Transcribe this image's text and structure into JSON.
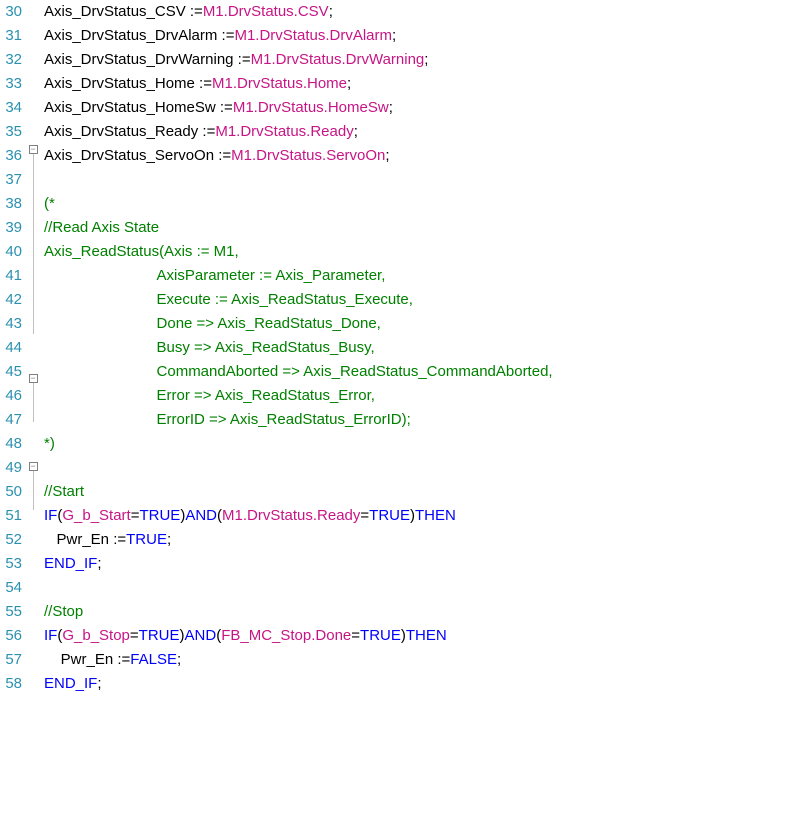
{
  "lines": [
    {
      "num": 30,
      "fold": "",
      "segments": [
        {
          "t": "Axis_DrvStatus_CSV := ",
          "c": "tok-default"
        },
        {
          "t": "M1.DrvStatus.CSV",
          "c": "tok-member"
        },
        {
          "t": ";",
          "c": "tok-default"
        }
      ]
    },
    {
      "num": 31,
      "fold": "",
      "segments": [
        {
          "t": "Axis_DrvStatus_DrvAlarm := ",
          "c": "tok-default"
        },
        {
          "t": "M1.DrvStatus.DrvAlarm",
          "c": "tok-member"
        },
        {
          "t": ";",
          "c": "tok-default"
        }
      ]
    },
    {
      "num": 32,
      "fold": "",
      "segments": [
        {
          "t": "Axis_DrvStatus_DrvWarning := ",
          "c": "tok-default"
        },
        {
          "t": "M1.DrvStatus.DrvWarning",
          "c": "tok-member"
        },
        {
          "t": ";",
          "c": "tok-default"
        }
      ]
    },
    {
      "num": 33,
      "fold": "",
      "segments": [
        {
          "t": "Axis_DrvStatus_Home := ",
          "c": "tok-default"
        },
        {
          "t": "M1.DrvStatus.Home",
          "c": "tok-member"
        },
        {
          "t": ";",
          "c": "tok-default"
        }
      ]
    },
    {
      "num": 34,
      "fold": "",
      "segments": [
        {
          "t": "Axis_DrvStatus_HomeSw := ",
          "c": "tok-default"
        },
        {
          "t": "M1.DrvStatus.HomeSw",
          "c": "tok-member"
        },
        {
          "t": ";",
          "c": "tok-default"
        }
      ]
    },
    {
      "num": 35,
      "fold": "",
      "segments": [
        {
          "t": "Axis_DrvStatus_Ready := ",
          "c": "tok-default"
        },
        {
          "t": "M1.DrvStatus.Ready",
          "c": "tok-member"
        },
        {
          "t": ";",
          "c": "tok-default"
        }
      ]
    },
    {
      "num": 36,
      "fold": "",
      "segments": [
        {
          "t": "Axis_DrvStatus_ServoOn := ",
          "c": "tok-default"
        },
        {
          "t": "M1.DrvStatus.ServoOn",
          "c": "tok-member"
        },
        {
          "t": ";",
          "c": "tok-default"
        }
      ]
    },
    {
      "num": 37,
      "fold": "",
      "segments": []
    },
    {
      "num": 38,
      "fold": "box",
      "segments": [
        {
          "t": "(*",
          "c": "tok-comment"
        }
      ]
    },
    {
      "num": 39,
      "fold": "v",
      "segments": [
        {
          "t": "//Read Axis State",
          "c": "tok-comment"
        }
      ]
    },
    {
      "num": 40,
      "fold": "v",
      "segments": [
        {
          "t": "Axis_ReadStatus(Axis := M1,",
          "c": "tok-comment"
        }
      ]
    },
    {
      "num": 41,
      "fold": "v",
      "segments": [
        {
          "t": "                           AxisParameter := Axis_Parameter,",
          "c": "tok-comment"
        }
      ]
    },
    {
      "num": 42,
      "fold": "v",
      "segments": [
        {
          "t": "                           Execute := Axis_ReadStatus_Execute,",
          "c": "tok-comment"
        }
      ]
    },
    {
      "num": 43,
      "fold": "v",
      "segments": [
        {
          "t": "                           Done => Axis_ReadStatus_Done,",
          "c": "tok-comment"
        }
      ]
    },
    {
      "num": 44,
      "fold": "v",
      "segments": [
        {
          "t": "                           Busy => Axis_ReadStatus_Busy,",
          "c": "tok-comment"
        }
      ]
    },
    {
      "num": 45,
      "fold": "v",
      "segments": [
        {
          "t": "                           CommandAborted => Axis_ReadStatus_CommandAborted,",
          "c": "tok-comment"
        }
      ]
    },
    {
      "num": 46,
      "fold": "v",
      "segments": [
        {
          "t": "                           Error => Axis_ReadStatus_Error,",
          "c": "tok-comment"
        }
      ]
    },
    {
      "num": 47,
      "fold": "v",
      "segments": [
        {
          "t": "                           ErrorID => Axis_ReadStatus_ErrorID);",
          "c": "tok-comment"
        }
      ]
    },
    {
      "num": 48,
      "fold": "v",
      "segments": [
        {
          "t": "*)",
          "c": "tok-comment"
        }
      ]
    },
    {
      "num": 49,
      "fold": "",
      "segments": []
    },
    {
      "num": 50,
      "fold": "",
      "segments": [
        {
          "t": "//Start",
          "c": "tok-comment"
        }
      ]
    },
    {
      "num": 51,
      "fold": "box",
      "segments": [
        {
          "t": "IF",
          "c": "tok-keyword"
        },
        {
          "t": " (",
          "c": "tok-default"
        },
        {
          "t": "G_b_Start",
          "c": "tok-var"
        },
        {
          "t": " = ",
          "c": "tok-default"
        },
        {
          "t": "TRUE",
          "c": "tok-keyword"
        },
        {
          "t": ") ",
          "c": "tok-default"
        },
        {
          "t": "AND",
          "c": "tok-keyword"
        },
        {
          "t": " (",
          "c": "tok-default"
        },
        {
          "t": "M1.DrvStatus.Ready",
          "c": "tok-member"
        },
        {
          "t": " = ",
          "c": "tok-default"
        },
        {
          "t": "TRUE",
          "c": "tok-keyword"
        },
        {
          "t": ") ",
          "c": "tok-default"
        },
        {
          "t": "THEN",
          "c": "tok-keyword"
        }
      ]
    },
    {
      "num": 52,
      "fold": "v",
      "segments": [
        {
          "t": "   Pwr_En := ",
          "c": "tok-default"
        },
        {
          "t": "TRUE",
          "c": "tok-keyword"
        },
        {
          "t": ";",
          "c": "tok-default"
        }
      ]
    },
    {
      "num": 53,
      "fold": "v",
      "segments": [
        {
          "t": "END_IF",
          "c": "tok-keyword"
        },
        {
          "t": ";",
          "c": "tok-default"
        }
      ]
    },
    {
      "num": 54,
      "fold": "",
      "segments": []
    },
    {
      "num": 55,
      "fold": "",
      "segments": [
        {
          "t": "//Stop",
          "c": "tok-comment"
        }
      ]
    },
    {
      "num": 56,
      "fold": "box",
      "segments": [
        {
          "t": "IF",
          "c": "tok-keyword"
        },
        {
          "t": " (",
          "c": "tok-default"
        },
        {
          "t": "G_b_Stop",
          "c": "tok-var"
        },
        {
          "t": " = ",
          "c": "tok-default"
        },
        {
          "t": "TRUE",
          "c": "tok-keyword"
        },
        {
          "t": ") ",
          "c": "tok-default"
        },
        {
          "t": "AND",
          "c": "tok-keyword"
        },
        {
          "t": " (",
          "c": "tok-default"
        },
        {
          "t": "FB_MC_Stop.Done",
          "c": "tok-member"
        },
        {
          "t": " = ",
          "c": "tok-default"
        },
        {
          "t": "TRUE",
          "c": "tok-keyword"
        },
        {
          "t": ") ",
          "c": "tok-default"
        },
        {
          "t": "THEN",
          "c": "tok-keyword"
        }
      ]
    },
    {
      "num": 57,
      "fold": "v",
      "segments": [
        {
          "t": "    Pwr_En := ",
          "c": "tok-default"
        },
        {
          "t": "FALSE",
          "c": "tok-keyword"
        },
        {
          "t": ";",
          "c": "tok-default"
        }
      ]
    },
    {
      "num": 58,
      "fold": "v",
      "segments": [
        {
          "t": "END_IF",
          "c": "tok-keyword"
        },
        {
          "t": ";",
          "c": "tok-default"
        }
      ]
    }
  ]
}
